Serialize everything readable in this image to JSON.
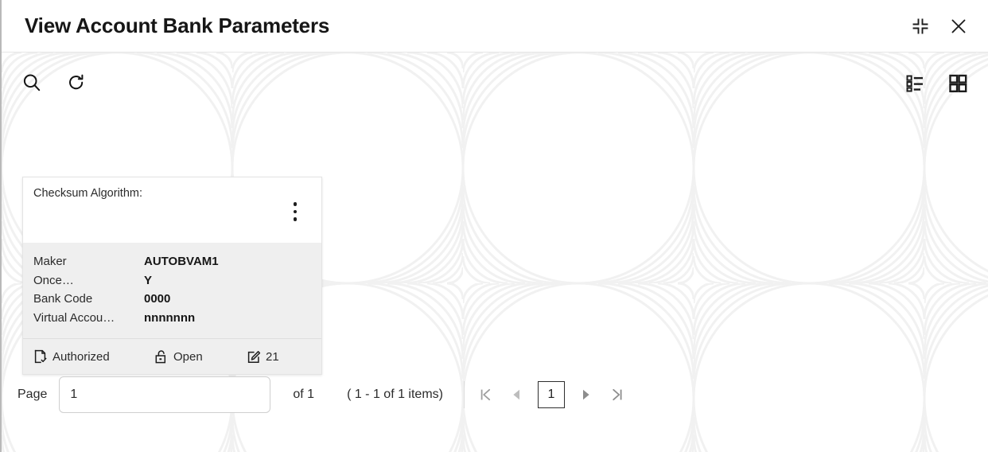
{
  "window": {
    "title": "View Account Bank Parameters",
    "minimize_icon": "collapse-icon",
    "close_icon": "close-icon"
  },
  "toolbar": {
    "search_icon": "search-icon",
    "refresh_icon": "refresh-icon",
    "list_view_icon": "list-view-icon",
    "grid_view_icon": "grid-view-icon"
  },
  "card": {
    "header_title": "Checksum Algorithm:",
    "menu_icon": "kebab-menu-icon",
    "fields": [
      {
        "key": "Maker",
        "value": "AUTOBVAM1"
      },
      {
        "key": "Once…",
        "value": "Y"
      },
      {
        "key": "Bank Code",
        "value": "0000"
      },
      {
        "key": "Virtual Accou…",
        "value": "nnnnnnn"
      }
    ],
    "footer": {
      "auth_status": "Authorized",
      "auth_icon": "document-check-icon",
      "record_status": "Open",
      "record_icon": "unlock-icon",
      "mod_number": "21",
      "mod_icon": "edit-square-icon"
    }
  },
  "pagination": {
    "page_label": "Page",
    "page_value": "1",
    "page_placeholder": "",
    "of_text": "of 1",
    "items_text": "( 1 - 1 of 1 items)",
    "current_page": "1",
    "first_icon": "first-page-icon",
    "prev_icon": "previous-page-icon",
    "next_icon": "next-page-icon",
    "last_icon": "last-page-icon"
  },
  "colors": {
    "text": "#2b2b2b",
    "heading": "#161616",
    "card_body": "#efefef",
    "disabled": "#bdbdbd",
    "watermark": "#f1f1f1"
  }
}
